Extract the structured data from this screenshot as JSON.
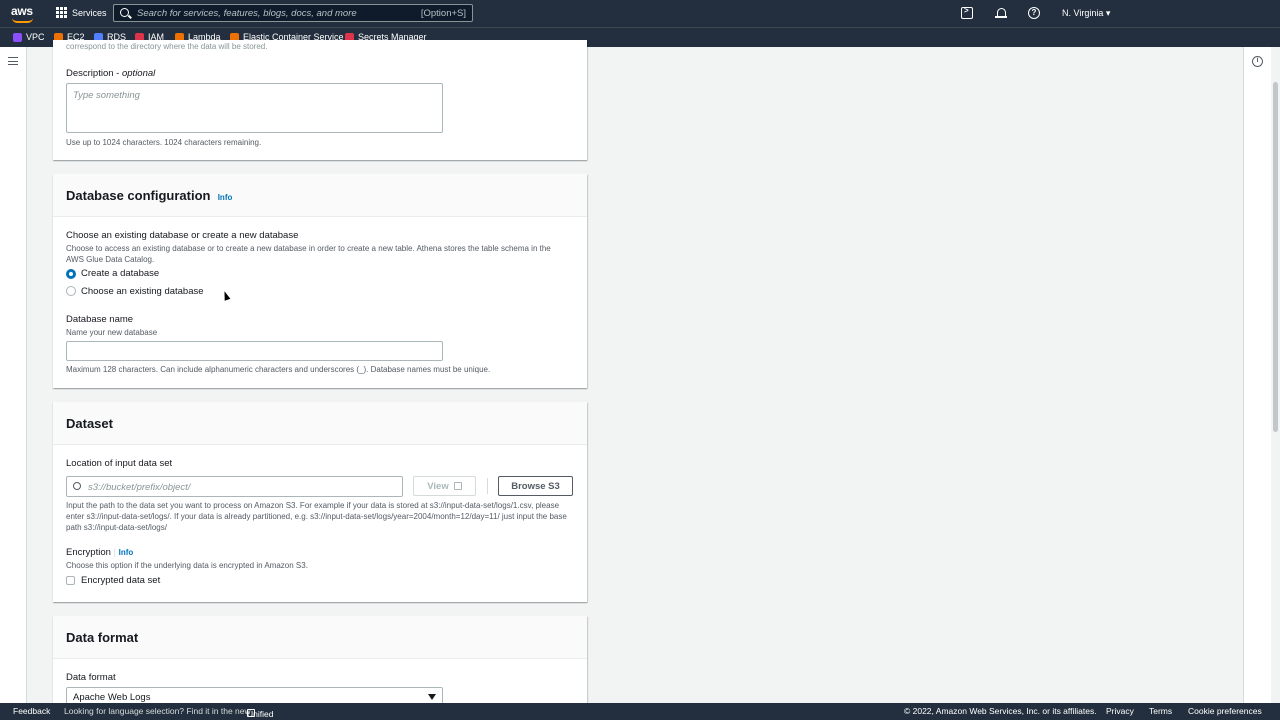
{
  "nav": {
    "logo": "aws",
    "services_label": "Services",
    "search_placeholder": "Search for services, features, blogs, docs, and more",
    "search_shortcut": "[Option+S]",
    "region": "N. Virginia ▾"
  },
  "favorites": [
    {
      "label": "VPC",
      "color": "#8c4fff"
    },
    {
      "label": "EC2",
      "color": "#ed7100"
    },
    {
      "label": "RDS",
      "color": "#527fff"
    },
    {
      "label": "IAM",
      "color": "#dd344c"
    },
    {
      "label": "Lambda",
      "color": "#ed7100"
    },
    {
      "label": "Elastic Container Service",
      "color": "#ed7100"
    },
    {
      "label": "Secrets Manager",
      "color": "#dd344c"
    }
  ],
  "top_panel": {
    "cut_text": "correspond to the directory where the data will be stored.",
    "description_label": "Description",
    "description_optional": "optional",
    "description_placeholder": "Type something",
    "description_hint": "Use up to 1024 characters. 1024 characters remaining."
  },
  "database": {
    "title": "Database configuration",
    "info": "Info",
    "choose_label": "Choose an existing database or create a new database",
    "choose_desc": "Choose to access an existing database or to create a new database in order to create a new table. Athena stores the table schema in the AWS Glue Data Catalog.",
    "option_create": "Create a database",
    "option_existing": "Choose an existing database",
    "name_label": "Database name",
    "name_desc": "Name your new database",
    "name_value": "",
    "name_hint": "Maximum 128 characters. Can include alphanumeric characters and underscores (_). Database names must be unique."
  },
  "dataset": {
    "title": "Dataset",
    "location_label": "Location of input data set",
    "location_placeholder": "s3://bucket/prefix/object/",
    "view_button": "View",
    "browse_button": "Browse S3",
    "location_desc": "Input the path to the data set you want to process on Amazon S3. For example if your data is stored at s3://input-data-set/logs/1.csv, please enter s3://input-data-set/logs/. If your data is already partitioned, e.g. s3://input-data-set/logs/year=2004/month=12/day=11/ just input the base path s3://input-data-set/logs/",
    "encryption_label": "Encryption",
    "encryption_info": "Info",
    "encryption_desc": "Choose this option if the underlying data is encrypted in Amazon S3.",
    "encrypted_checkbox": "Encrypted data set"
  },
  "data_format": {
    "title": "Data format",
    "format_label": "Data format",
    "format_value": "Apache Web Logs"
  },
  "footer": {
    "feedback": "Feedback",
    "language_note": "Looking for language selection? Find it in the new",
    "unified_settings": "Unified Settings",
    "copyright": "© 2022, Amazon Web Services, Inc. or its affiliates.",
    "privacy": "Privacy",
    "terms": "Terms",
    "cookie": "Cookie preferences"
  }
}
